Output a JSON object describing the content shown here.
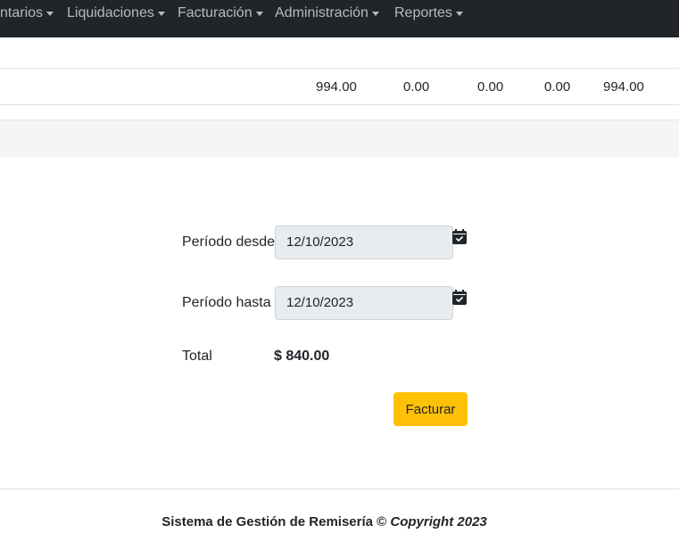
{
  "navbar": {
    "items": [
      {
        "label": "ntarios"
      },
      {
        "label": "Liquidaciones"
      },
      {
        "label": "Facturación"
      },
      {
        "label": "Administración"
      },
      {
        "label": "Reportes"
      }
    ]
  },
  "table": {
    "row": [
      "994.00",
      "0.00",
      "0.00",
      "0.00",
      "994.00"
    ]
  },
  "form": {
    "periodo_desde_label": "Período desde",
    "periodo_desde_value": "12/10/2023",
    "periodo_hasta_label": "Período hasta",
    "periodo_hasta_value": "12/10/2023",
    "total_label": "Total",
    "total_value": "$ 840.00",
    "submit_label": "Facturar"
  },
  "footer": {
    "text": "Sistema de Gestión de Remisería ©",
    "copyright": "Copyright 2023"
  },
  "colors": {
    "navbar_bg": "#212529",
    "button_warning": "#ffc107"
  },
  "icons": [
    "caret-down-icon",
    "calendar-check-icon"
  ]
}
